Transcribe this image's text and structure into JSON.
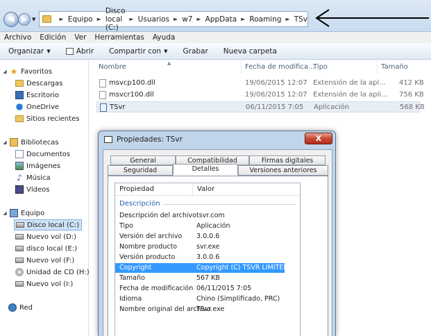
{
  "address": {
    "crumbs": [
      "Equipo",
      "Disco local (C:)",
      "Usuarios",
      "w7",
      "AppData",
      "Roaming",
      "TSv"
    ]
  },
  "menu": [
    "Archivo",
    "Edición",
    "Ver",
    "Herramientas",
    "Ayuda"
  ],
  "commands": {
    "organize": "Organizar",
    "open": "Abrir",
    "share": "Compartir con",
    "burn": "Grabar",
    "new_folder": "Nueva carpeta"
  },
  "nav": {
    "favorites": "Favoritos",
    "downloads": "Descargas",
    "desktop": "Escritorio",
    "onedrive": "OneDrive",
    "recent": "Sitios recientes",
    "libraries": "Bibliotecas",
    "documents": "Documentos",
    "images": "Imágenes",
    "music": "Música",
    "videos": "Vídeos",
    "computer": "Equipo",
    "drive_c": "Disco local (C:)",
    "drive_d": "Nuevo vol (D:)",
    "drive_e": "disco local (E:)",
    "drive_f": "Nuevo vol (F:)",
    "drive_h": "Unidad de CD (H:)",
    "drive_i": "Nuevo vol (I:)",
    "network": "Red"
  },
  "files": {
    "headers": {
      "name": "Nombre",
      "date": "Fecha de modifica...",
      "type": "Tipo",
      "size": "Tamaño"
    },
    "rows": [
      {
        "name": "msvcp100.dll",
        "date": "19/06/2015 12:07",
        "type": "Extensión de la apl...",
        "size": "412 KB"
      },
      {
        "name": "msvcr100.dll",
        "date": "19/06/2015 12:07",
        "type": "Extensión de la apli...",
        "size": "756 KB"
      },
      {
        "name": "TSvr",
        "date": "06/11/2015 7:05",
        "type": "Aplicación",
        "size": "568 KB"
      }
    ]
  },
  "dialog": {
    "title": "Propiedades: TSvr",
    "close": "X",
    "tabs": {
      "general": "General",
      "compat": "Compatibilidad",
      "signatures": "Firmas digitales",
      "security": "Seguridad",
      "details": "Detalles",
      "versions": "Versiones anteriores"
    },
    "list": {
      "h_prop": "Propiedad",
      "h_value": "Valor",
      "group": "Descripción",
      "rows": [
        {
          "k": "Descripción del archivo",
          "v": "tsvr.com"
        },
        {
          "k": "Tipo",
          "v": "Aplicación"
        },
        {
          "k": "Versión del archivo",
          "v": "3.0.0.6"
        },
        {
          "k": "Nombre producto",
          "v": "svr.exe"
        },
        {
          "k": "Versión producto",
          "v": "3.0.0.6"
        },
        {
          "k": "Copyright",
          "v": "Copyright (C) TSVR LIMITED..."
        },
        {
          "k": "Tamaño",
          "v": "567 KB"
        },
        {
          "k": "Fecha de modificación",
          "v": "06/11/2015 7:05"
        },
        {
          "k": "Idioma",
          "v": "Chino (Simplificado, PRC)"
        },
        {
          "k": "Nombre original del archivo",
          "v": "TSvr.exe"
        }
      ]
    }
  }
}
